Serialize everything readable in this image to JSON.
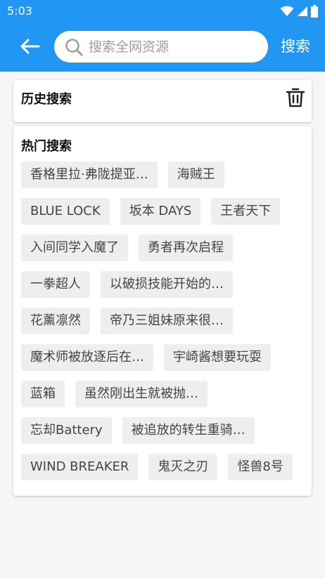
{
  "status": {
    "time": "5:03"
  },
  "search": {
    "placeholder": "搜索全网资源",
    "button_label": "搜索"
  },
  "history": {
    "title": "历史搜索"
  },
  "hot": {
    "title": "热门搜索",
    "rows": [
      [
        "香格里拉·弗陇提亚…",
        "海贼王"
      ],
      [
        "BLUE LOCK",
        "坂本 DAYS",
        "王者天下"
      ],
      [
        "入间同学入魔了",
        "勇者再次启程"
      ],
      [
        "一拳超人",
        "以破损技能开始的…"
      ],
      [
        "花薰凛然",
        "帝乃三姐妹原来很…"
      ],
      [
        "魔术师被放逐后在…",
        "宇崎酱想要玩耍"
      ],
      [
        "蓝箱",
        "虽然刚出生就被抛…"
      ],
      [
        "忘却Battery",
        "被追放的转生重骑…"
      ],
      [
        "WIND BREAKER",
        "鬼灭之刃",
        "怪兽8号"
      ]
    ]
  },
  "colors": {
    "primary": "#2196f3",
    "tag_bg": "#eeeeee"
  }
}
